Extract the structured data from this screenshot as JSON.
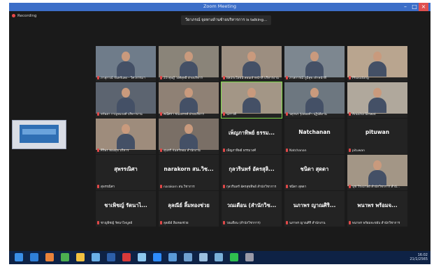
{
  "window": {
    "title": "Zoom Meeting",
    "min": "–",
    "max": "□",
    "close": "×"
  },
  "recording": {
    "label": "Recording"
  },
  "toast": {
    "text": "วีดาภรณ์ จุดทางด้านซ้ายบริหารการ is talking..."
  },
  "colors": {
    "titlebar": "#3c6ec8",
    "background": "#1a1a1a",
    "muted_mic": "#e04848",
    "active_speaker": "#7fdc4a",
    "taskbar": "#0e2245"
  },
  "participants": [
    {
      "label": "ภาสุกาณ์ จันทร์แดง - วิศวกรรมฯ",
      "big": "",
      "video": true
    },
    {
      "label": "23 ดุษฎี วงศ์สุทธิ์ ฝ่ายบริหาร",
      "big": "",
      "video": true
    },
    {
      "label": "ผลประโยชน์ สอนเจ้าหน้าที่ บริหารงาน",
      "big": "",
      "video": true
    },
    {
      "label": "ภาสการณ์ ภูมิสุข เจ้าหน้าที่",
      "big": "",
      "video": true
    },
    {
      "label": "Phusutong",
      "big": "",
      "video": true
    },
    {
      "label": "ทรัพยา กาญจนวงศ์ บริหารงาน",
      "big": "",
      "video": true
    },
    {
      "label": "คณิศรา ชนะสรรค์ ฝ่ายบริหาร",
      "big": "",
      "video": true
    },
    {
      "label": "นภาวดี",
      "big": "",
      "video": true
    },
    {
      "label": "จตุรพร รุ่งทองคำ ปฏิบัติงาน",
      "big": "",
      "video": true
    },
    {
      "label": "Anucha Siriwat",
      "big": "",
      "video": true
    },
    {
      "label": "ศิริพร ทองสุข บริหาร",
      "big": "",
      "video": true
    },
    {
      "label": "สุนทรี จันทร์หอม สำนักงาน",
      "big": "",
      "video": true
    },
    {
      "label": "เพ็ญภาทิพย์ ธรรมวงศ์",
      "big": "เพ็ญภาทิพย์ ธรรม...",
      "video": false
    },
    {
      "label": "Natchanan",
      "big": "Natchanan",
      "video": false
    },
    {
      "label": "pituwan",
      "big": "pituwan",
      "video": false
    },
    {
      "label": "สุพรรณิศา",
      "big": "สุพรรณิศา",
      "video": false
    },
    {
      "label": "narakorn สน.วิชาการ",
      "big": "narakorn สน.วิช...",
      "video": false
    },
    {
      "label": "กุลวรินทร์ อัครสุขทิพย์ สำนักวิชาการ",
      "big": "กุลวรินทร์ อัครสุลิ...",
      "video": false
    },
    {
      "label": "ชนิดา สุดดา",
      "big": "ชนิดา สุดดา",
      "video": false
    },
    {
      "label": "นุช วีระมาลย์ สำนักวิชาการ สำนั...",
      "big": "",
      "video": true
    },
    {
      "label": "ชาญพิชญ์ รัตนาไพบูลย์",
      "big": "ชาเพิชญ์ รัตนาไ...",
      "video": false
    },
    {
      "label": "ลุลณีย์ ลิ้มทองช่วย",
      "big": "ลุลณีย์ ลิ้มทองช่วย",
      "video": false
    },
    {
      "label": "วณเดือน (สำนักวิชาการ)",
      "big": "วณเดือน (สำนักวิช...",
      "video": false
    },
    {
      "label": "นภาพร ญาณศิริ สำนักงาน",
      "big": "นภาพร ญาณศิริ...",
      "video": false
    },
    {
      "label": "พนาพร พร้อมจะขยับ สำนักวิชาการ",
      "big": "พนาพร พร้อมจ...",
      "video": false
    }
  ],
  "taskbar": {
    "icons": [
      "start-icon",
      "edge-icon",
      "firefox-icon",
      "chrome-icon",
      "files-icon",
      "app-icon",
      "photoshop-icon",
      "acrobat-icon",
      "media-icon",
      "zoom-icon",
      "app2-icon",
      "app3-icon",
      "app4-icon",
      "app5-icon",
      "line-icon",
      "app6-icon"
    ],
    "tray_time": "16:02",
    "tray_date": "21/1/2565"
  }
}
